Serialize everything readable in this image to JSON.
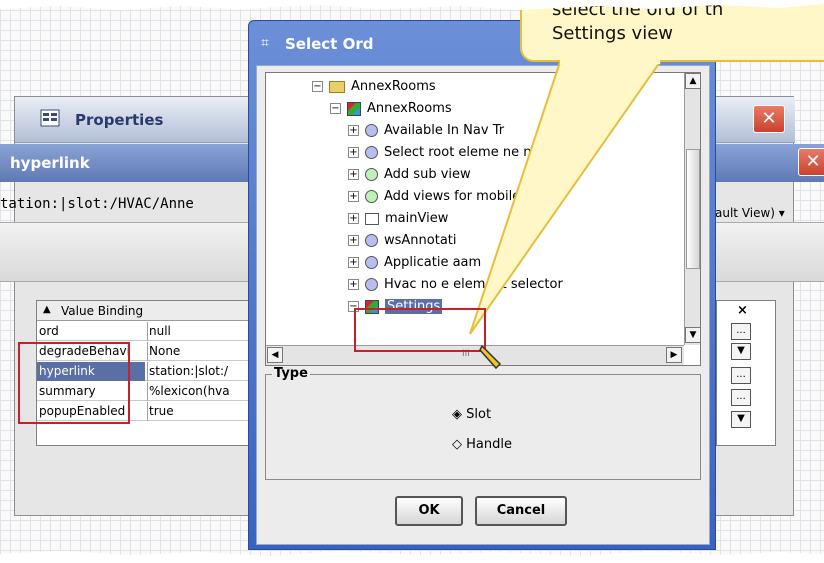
{
  "callout": {
    "text_line1": "select the ord of th",
    "text_line2": "Settings view"
  },
  "properties": {
    "title": "Properties",
    "close_glyph": "✕",
    "hyperlink_tab": "hyperlink",
    "slot_path": "tation:|slot:/HVAC/Anne",
    "default_view": "ault View) ▾"
  },
  "value_binding": {
    "header": "Value Binding",
    "sort_glyph": "▲",
    "rows": [
      {
        "name": "ord",
        "value": "null"
      },
      {
        "name": "degradeBehavi",
        "value": "None"
      },
      {
        "name": "hyperlink",
        "value": "station:|slot:/"
      },
      {
        "name": "summary",
        "value": "%lexicon(hva"
      },
      {
        "name": "popupEnabled",
        "value": "true"
      }
    ],
    "right_header": "×",
    "right_buttons": [
      "...",
      "▼",
      "...",
      "...",
      "▼"
    ]
  },
  "dialog": {
    "title": "Select Ord",
    "tree": [
      {
        "label": "AnnexRooms",
        "icon": "folder-icon",
        "expander": "−",
        "indent": 0
      },
      {
        "label": "AnnexRooms",
        "icon": "nav-node-icon",
        "expander": "−",
        "indent": 1
      },
      {
        "label": "Available In Nav Tr",
        "icon": "circle-icon",
        "expander": "+",
        "indent": 2
      },
      {
        "label": "Select root eleme      ne nav-tree",
        "icon": "circle-icon",
        "expander": "+",
        "indent": 2
      },
      {
        "label": "Add sub view",
        "icon": "circle-green-icon",
        "expander": "+",
        "indent": 2
      },
      {
        "label": "Add views for      mobile profile",
        "icon": "circle-green-icon",
        "expander": "+",
        "indent": 2
      },
      {
        "label": "mainView",
        "icon": "view-icon",
        "expander": "+",
        "indent": 2
      },
      {
        "label": "wsAnnotati",
        "icon": "circle-icon",
        "expander": "+",
        "indent": 2
      },
      {
        "label": "Applicatie  aam",
        "icon": "circle-icon",
        "expander": "+",
        "indent": 2
      },
      {
        "label": "Hvac no e element selector",
        "icon": "circle-icon",
        "expander": "+",
        "indent": 2
      },
      {
        "label": "Settings",
        "icon": "nav-node-icon",
        "expander": "−",
        "indent": 2,
        "selected": true
      }
    ],
    "hscroll_label": "III",
    "type_label": "Type",
    "radios": [
      {
        "label": "Slot",
        "checked": true
      },
      {
        "label": "Handle",
        "checked": false
      }
    ],
    "ok_label": "OK",
    "cancel_label": "Cancel"
  }
}
